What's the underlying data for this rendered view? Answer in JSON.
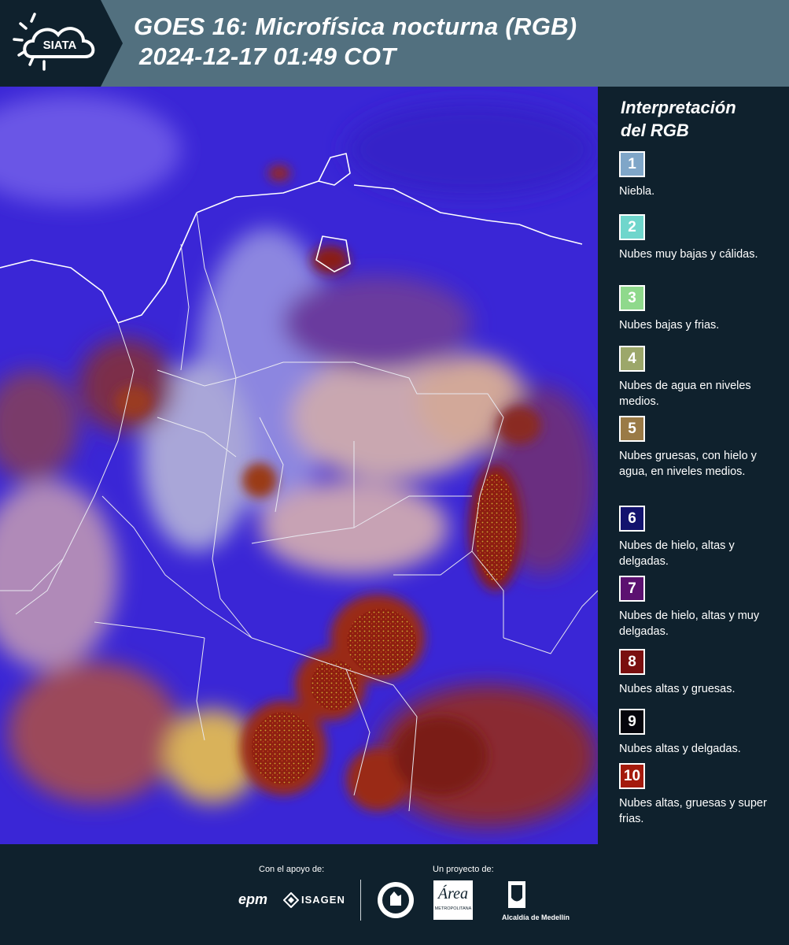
{
  "header": {
    "logo_text": "SIATA",
    "title_line1": "GOES 16: Microfísica nocturna (RGB)",
    "title_line2": "2024-12-17 01:49 COT",
    "colors": {
      "header_bg": "#52707f",
      "logo_bg": "#0f212d"
    }
  },
  "legend": {
    "title_line1": "Interpretación",
    "title_line2": "del RGB",
    "items": [
      {
        "num": "1",
        "label": "Niebla.",
        "color": "#7fa6c8"
      },
      {
        "num": "2",
        "label": "Nubes muy bajas y cálidas.",
        "color": "#6fd6cc"
      },
      {
        "num": "3",
        "label": "Nubes bajas y frias.",
        "color": "#8fd98c"
      },
      {
        "num": "4",
        "label": "Nubes de agua en niveles medios.",
        "color": "#9ca76a"
      },
      {
        "num": "5",
        "label": "Nubes gruesas, con hielo y agua, en niveles medios.",
        "color": "#9a7a46"
      },
      {
        "num": "6",
        "label": "Nubes de hielo, altas y delgadas.",
        "color": "#13136e"
      },
      {
        "num": "7",
        "label": "Nubes de hielo, altas y muy delgadas.",
        "color": "#5c1170"
      },
      {
        "num": "8",
        "label": "Nubes altas y gruesas.",
        "color": "#7a0f0f"
      },
      {
        "num": "9",
        "label": "Nubes altas y delgadas.",
        "color": "#05050c"
      },
      {
        "num": "10",
        "label": "Nubes altas, gruesas y super frias.",
        "color": "#a41a0c"
      }
    ]
  },
  "footer": {
    "support_label": "Con el apoyo de:",
    "project_label": "Un proyecto de:",
    "sponsor1": "epm",
    "sponsor2": "ISAGEN",
    "partner_area": "Área",
    "partner_area_sub": "METROPOLITANA",
    "partner_alcaldia": "Alcaldía de Medellín"
  }
}
